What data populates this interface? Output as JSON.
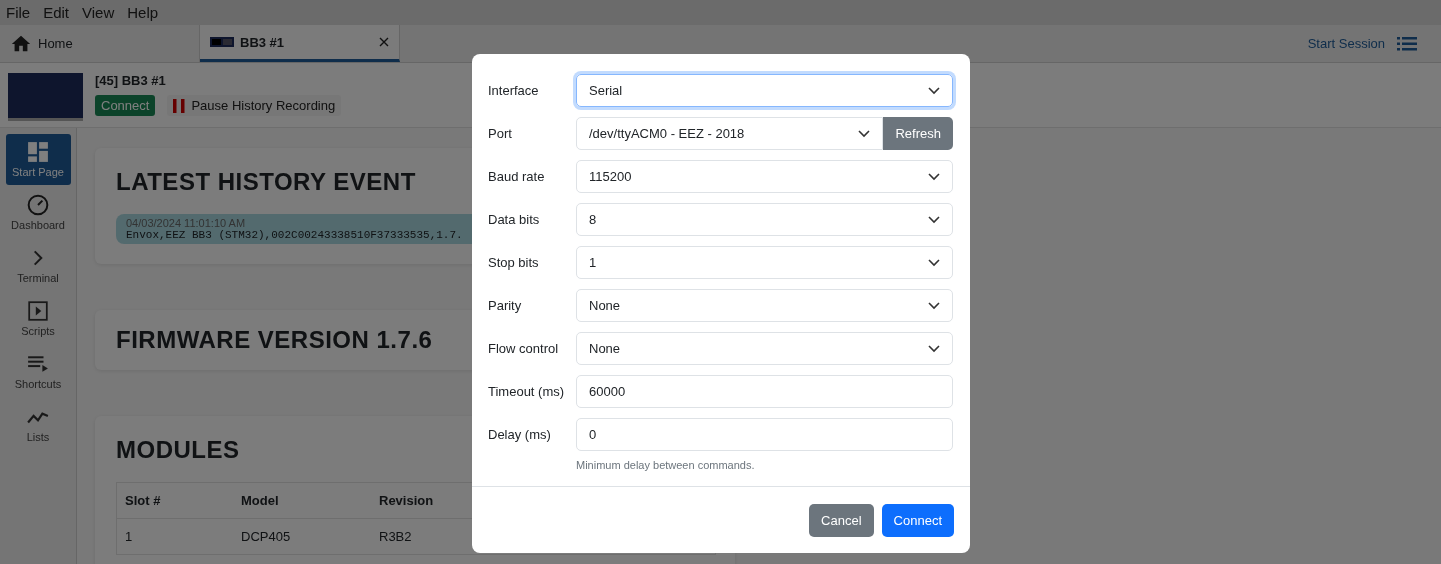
{
  "menu": [
    "File",
    "Edit",
    "View",
    "Help"
  ],
  "tabs": [
    {
      "label": "Home",
      "kind": "home",
      "selected": false
    },
    {
      "label": "BB3 #1",
      "kind": "instrument",
      "selected": true
    }
  ],
  "session": {
    "label": "Start Session"
  },
  "instrument": {
    "title": "[45] BB3 #1",
    "connect_button": "Connect",
    "pause_button": "Pause History Recording"
  },
  "sidebar": {
    "items": [
      {
        "label": "Start Page",
        "kind": "start",
        "selected": true
      },
      {
        "label": "Dashboard",
        "kind": "dashboard",
        "selected": false
      },
      {
        "label": "Terminal",
        "kind": "terminal",
        "selected": false
      },
      {
        "label": "Scripts",
        "kind": "scripts",
        "selected": false
      },
      {
        "label": "Shortcuts",
        "kind": "shortcuts",
        "selected": false
      },
      {
        "label": "Lists",
        "kind": "lists",
        "selected": false
      }
    ]
  },
  "latest_history_event": {
    "title": "LATEST HISTORY EVENT",
    "time": "04/03/2024 11:01:10 AM",
    "text": "Envox,EEZ BB3 (STM32),002C00243338510F37333535,1.7."
  },
  "firmware": {
    "title": "FIRMWARE VERSION 1.7.6"
  },
  "modules": {
    "title": "MODULES",
    "columns": [
      "Slot #",
      "Model",
      "Revision"
    ],
    "rows": [
      [
        "1",
        "DCP405",
        "R3B2"
      ]
    ]
  },
  "dialog": {
    "fields": [
      {
        "label": "Interface",
        "kind": "select",
        "value": "Serial",
        "focused": true
      },
      {
        "label": "Port",
        "kind": "select",
        "value": "/dev/ttyACM0 - EEZ - 2018",
        "button": "Refresh",
        "focused": false
      },
      {
        "label": "Baud rate",
        "kind": "select",
        "value": "115200",
        "focused": false
      },
      {
        "label": "Data bits",
        "kind": "select",
        "value": "8",
        "focused": false
      },
      {
        "label": "Stop bits",
        "kind": "select",
        "value": "1",
        "focused": false
      },
      {
        "label": "Parity",
        "kind": "select",
        "value": "None",
        "focused": false
      },
      {
        "label": "Flow control",
        "kind": "select",
        "value": "None",
        "focused": false
      },
      {
        "label": "Timeout (ms)",
        "kind": "input",
        "value": "60000",
        "focused": false
      },
      {
        "label": "Delay (ms)",
        "kind": "input",
        "value": "0",
        "hint": "Minimum delay between commands.",
        "focused": false
      }
    ],
    "buttons": [
      {
        "label": "Cancel",
        "kind": "secondary"
      },
      {
        "label": "Connect",
        "kind": "primary"
      }
    ]
  }
}
